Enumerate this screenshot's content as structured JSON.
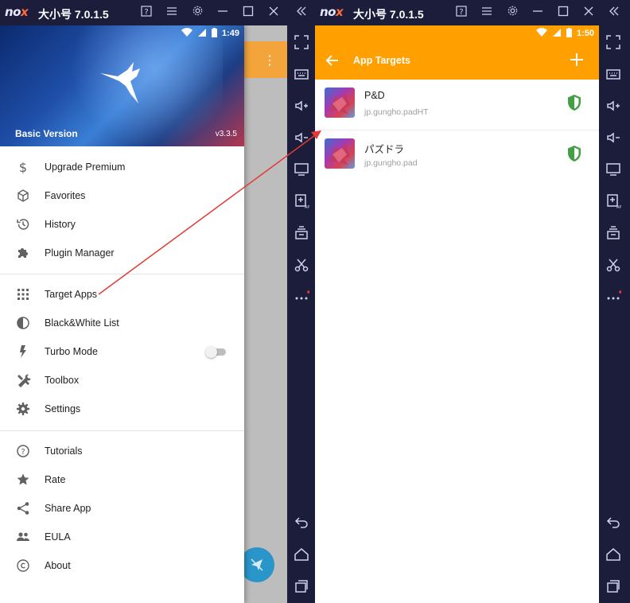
{
  "left_window": {
    "title": "大小号 7.0.1.5",
    "status_time": "1:49",
    "drawer": {
      "version_label": "Basic Version",
      "version_number": "v3.3.5",
      "items_top": [
        {
          "label": "Upgrade Premium",
          "icon": "dollar-icon"
        },
        {
          "label": "Favorites",
          "icon": "cube-icon"
        },
        {
          "label": "History",
          "icon": "history-icon"
        },
        {
          "label": "Plugin Manager",
          "icon": "puzzle-icon"
        }
      ],
      "items_mid": [
        {
          "label": "Target Apps",
          "icon": "grid-icon"
        },
        {
          "label": "Black&White List",
          "icon": "contrast-icon"
        },
        {
          "label": "Turbo Mode",
          "icon": "bolt-icon"
        },
        {
          "label": "Toolbox",
          "icon": "tools-icon"
        },
        {
          "label": "Settings",
          "icon": "gear-icon"
        }
      ],
      "items_bottom": [
        {
          "label": "Tutorials",
          "icon": "help-icon"
        },
        {
          "label": "Rate",
          "icon": "star-icon"
        },
        {
          "label": "Share App",
          "icon": "share-icon"
        },
        {
          "label": "EULA",
          "icon": "people-icon"
        },
        {
          "label": "About",
          "icon": "copyright-icon"
        }
      ],
      "turbo_mode_enabled": false
    }
  },
  "right_window": {
    "title": "大小号 7.0.1.5",
    "status_time": "1:50",
    "appbar_title": "App Targets",
    "apps": [
      {
        "name": "P&D",
        "package": "jp.gungho.padHT"
      },
      {
        "name": "パズドラ",
        "package": "jp.gungho.pad"
      }
    ]
  },
  "colors": {
    "emulator_bg": "#1b1d3a",
    "appbar": "#ffa000",
    "shield": "#43a047",
    "arrow": "#e53935"
  }
}
